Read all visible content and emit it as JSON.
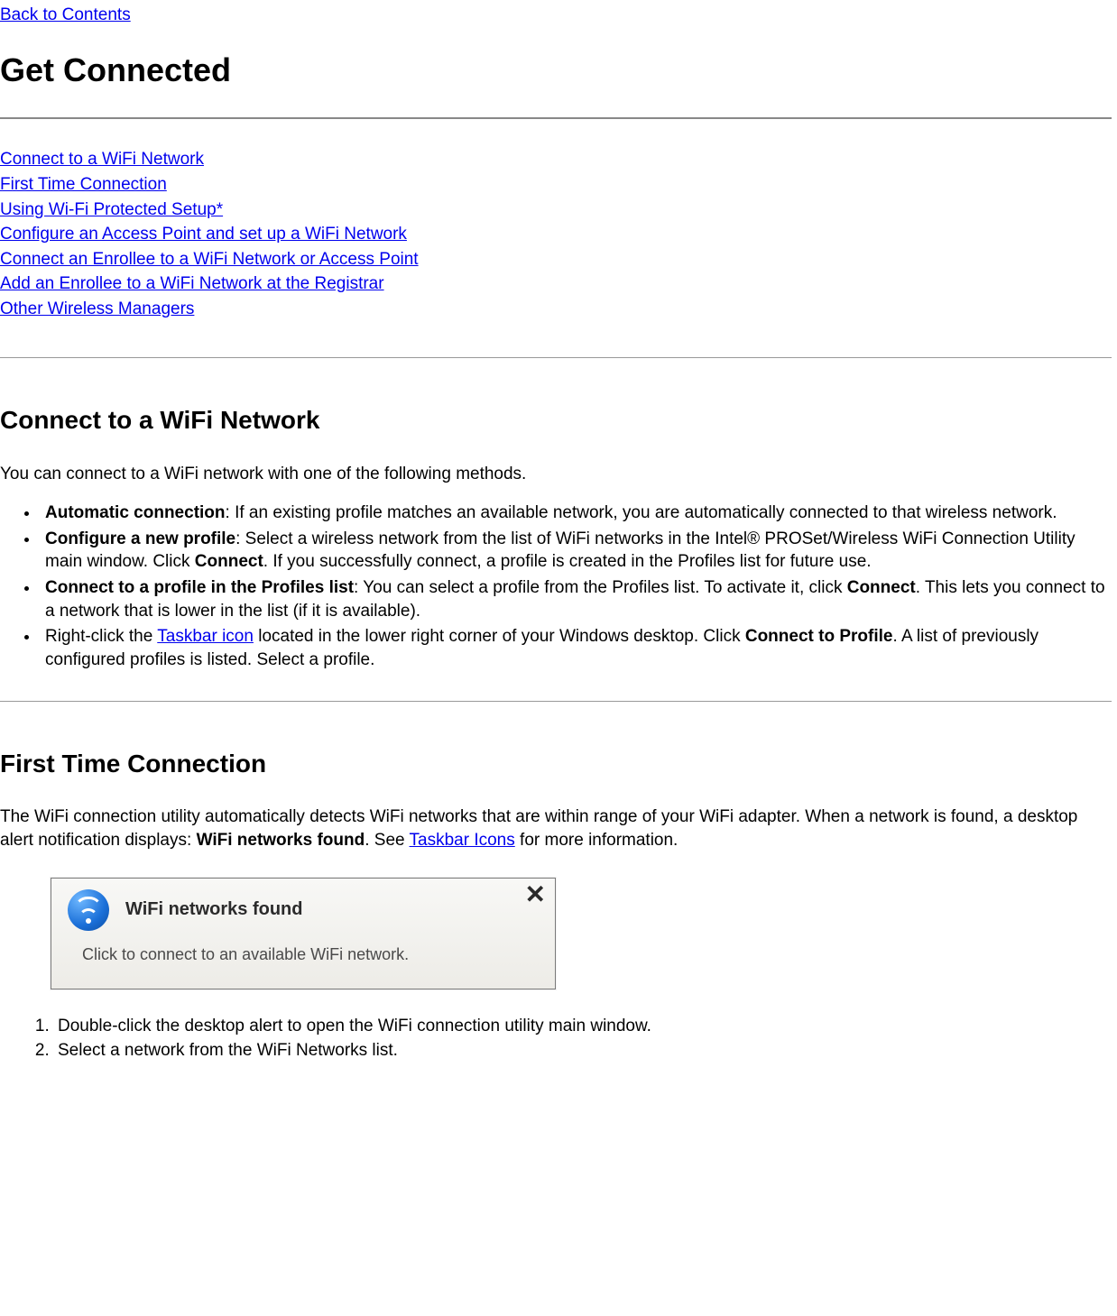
{
  "nav": {
    "back": "Back to Contents"
  },
  "title": "Get Connected",
  "toc": [
    "Connect to a WiFi Network",
    "First Time Connection",
    "Using Wi-Fi Protected Setup*",
    "Configure an Access Point and set up a WiFi Network",
    "Connect an Enrollee to a WiFi Network or Access Point",
    "Add an Enrollee to a WiFi Network at the Registrar",
    "Other Wireless Managers"
  ],
  "section1": {
    "heading": "Connect to a WiFi Network",
    "intro": "You can connect to a WiFi network with one of the following methods.",
    "items": [
      {
        "bold": "Automatic connection",
        "rest": ": If an existing profile matches an available network, you are automatically connected to that wireless network."
      },
      {
        "bold": "Configure a new profile",
        "rest_a": ": Select a wireless network from the list of WiFi networks in the Intel® PROSet/Wireless WiFi Connection Utility main window. Click ",
        "bold2": "Connect",
        "rest_b": ". If you successfully connect, a profile is created in the Profiles list for future use."
      },
      {
        "bold": "Connect to a profile in the Profiles list",
        "rest_a": ": You can select a profile from the Profiles list. To activate it, click ",
        "bold2": "Connect",
        "rest_b": ". This lets you connect to a network that is lower in the list (if it is available)."
      },
      {
        "pre": "Right-click the ",
        "link": "Taskbar icon",
        "rest_a": " located in the lower right corner of your Windows desktop. Click ",
        "bold2": "Connect to Profile",
        "rest_b": ". A list of previously configured profiles is listed. Select a profile."
      }
    ]
  },
  "section2": {
    "heading": "First Time Connection",
    "p_a": "The WiFi connection utility automatically detects WiFi networks that are within range of your WiFi adapter. When a network is found, a desktop alert notification displays: ",
    "p_bold": "WiFi networks found",
    "p_b": ". See ",
    "p_link": "Taskbar Icons",
    "p_c": " for more information.",
    "notif_title": "WiFi networks found",
    "notif_sub": "Click to connect to an available WiFi network.",
    "steps": [
      "Double-click the desktop alert to open the WiFi connection utility main window.",
      "Select a network from the WiFi Networks list."
    ]
  }
}
